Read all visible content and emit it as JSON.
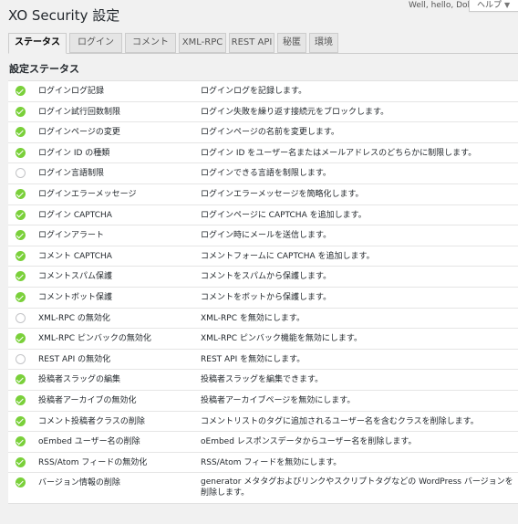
{
  "header": {
    "greeting": "Well, hello, Dolly",
    "help_label": "ヘルプ",
    "title": "XO Security 設定"
  },
  "tabs": [
    {
      "label": "ステータス",
      "active": true
    },
    {
      "label": "ログイン",
      "active": false
    },
    {
      "label": "コメント",
      "active": false
    },
    {
      "label": "XML-RPC",
      "active": false
    },
    {
      "label": "REST API",
      "active": false
    },
    {
      "label": "秘匿",
      "active": false
    },
    {
      "label": "環境",
      "active": false
    }
  ],
  "section_title": "設定ステータス",
  "rows": [
    {
      "name": "ログインログ記録",
      "description": "ログインログを記録します。",
      "enabled": true
    },
    {
      "name": "ログイン試行回数制限",
      "description": "ログイン失敗を繰り返す接続元をブロックします。",
      "enabled": true
    },
    {
      "name": "ログインページの変更",
      "description": "ログインページの名前を変更します。",
      "enabled": true
    },
    {
      "name": "ログイン ID の種類",
      "description": "ログイン ID をユーザー名またはメールアドレスのどちらかに制限します。",
      "enabled": true
    },
    {
      "name": "ログイン言語制限",
      "description": "ログインできる言語を制限します。",
      "enabled": false
    },
    {
      "name": "ログインエラーメッセージ",
      "description": "ログインエラーメッセージを簡略化します。",
      "enabled": true
    },
    {
      "name": "ログイン CAPTCHA",
      "description": "ログインページに CAPTCHA を追加します。",
      "enabled": true
    },
    {
      "name": "ログインアラート",
      "description": "ログイン時にメールを送信します。",
      "enabled": true
    },
    {
      "name": "コメント CAPTCHA",
      "description": "コメントフォームに CAPTCHA を追加します。",
      "enabled": true
    },
    {
      "name": "コメントスパム保護",
      "description": "コメントをスパムから保護します。",
      "enabled": true
    },
    {
      "name": "コメントボット保護",
      "description": "コメントをボットから保護します。",
      "enabled": true
    },
    {
      "name": "XML-RPC の無効化",
      "description": "XML-RPC を無効にします。",
      "enabled": false
    },
    {
      "name": "XML-RPC ピンバックの無効化",
      "description": "XML-RPC ピンバック機能を無効にします。",
      "enabled": true
    },
    {
      "name": "REST API の無効化",
      "description": "REST API を無効にします。",
      "enabled": false
    },
    {
      "name": "投稿者スラッグの編集",
      "description": "投稿者スラッグを編集できます。",
      "enabled": true
    },
    {
      "name": "投稿者アーカイブの無効化",
      "description": "投稿者アーカイブページを無効にします。",
      "enabled": true
    },
    {
      "name": "コメント投稿者クラスの削除",
      "description": "コメントリストのタグに追加されるユーザー名を含むクラスを削除します。",
      "enabled": true
    },
    {
      "name": "oEmbed ユーザー名の削除",
      "description": "oEmbed レスポンスデータからユーザー名を削除します。",
      "enabled": true
    },
    {
      "name": "RSS/Atom フィードの無効化",
      "description": "RSS/Atom フィードを無効にします。",
      "enabled": true
    },
    {
      "name": "バージョン情報の削除",
      "description": "generator メタタグおよびリンクやスクリプトタグなどの WordPress バージョンを削除します。",
      "enabled": true
    }
  ],
  "icons": {
    "enabled": "check-circle-icon",
    "disabled": "empty-circle-icon"
  },
  "colors": {
    "enabled": "#7ad03a",
    "disabled_border": "#c3c4c7"
  }
}
